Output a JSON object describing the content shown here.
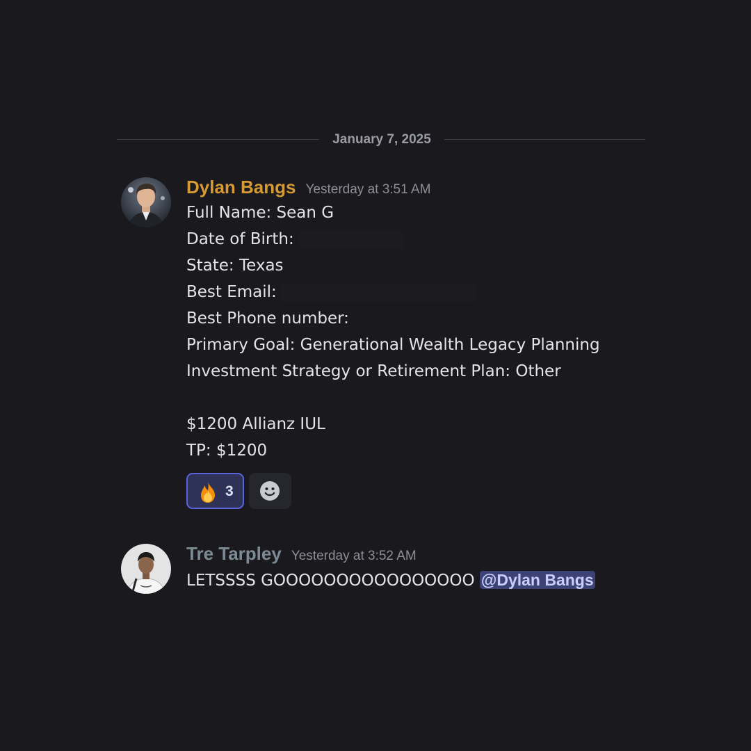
{
  "theme": {
    "background": "#1a1a1e",
    "divider_line": "#3c3e44",
    "text_primary": "#e3e4e8",
    "text_muted": "#8d8f96",
    "mention_bg": "#3d4275",
    "mention_text": "#c9cdfb",
    "reaction_active_bg": "#2e3256",
    "reaction_active_border": "#5b63d9"
  },
  "date_divider": {
    "label": "January 7, 2025"
  },
  "messages": [
    {
      "author": "Dylan Bangs",
      "author_color": "#d69a35",
      "avatar_icon": "user-avatar-dylan",
      "timestamp": "Yesterday at 3:51 AM",
      "lines": [
        "Full Name: Sean G",
        "Date of Birth:",
        "State: Texas",
        "Best Email:",
        "Best Phone number:",
        "Primary Goal: Generational Wealth Legacy Planning",
        "Investment Strategy or Retirement Plan: Other",
        "",
        "$1200 Allianz IUL",
        "TP: $1200"
      ],
      "reactions": [
        {
          "emoji": "fire-emoji",
          "count": "3",
          "active": true
        }
      ],
      "add_reaction_icon": "add-reaction-smile-icon"
    },
    {
      "author": "Tre Tarpley",
      "author_color": "#7c8b93",
      "avatar_icon": "user-avatar-tre",
      "timestamp": "Yesterday at 3:52 AM",
      "text": "LETSSSS GOOOOOOOOOOOOOOOO",
      "mention": "@Dylan Bangs"
    }
  ]
}
